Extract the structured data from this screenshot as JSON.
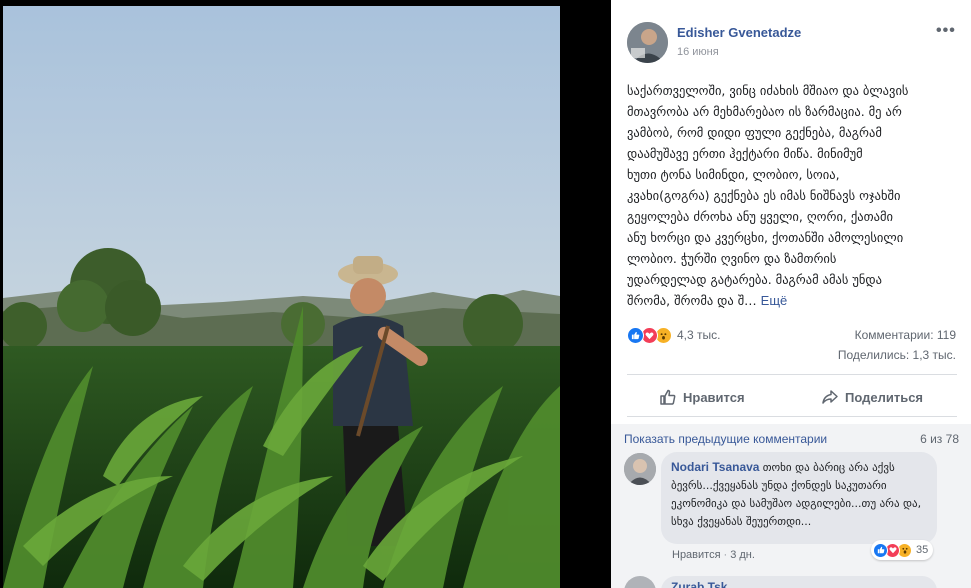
{
  "post": {
    "author": "Edisher Gvenetadze",
    "date": "16 июня",
    "more_label": "•••",
    "text_lines": [
      "საქართველოში, ვინც იძახის მშიაო და ბლავის",
      "მთავრობა არ მეხმარებაო ის ზარმაცია. მე არ",
      "ვამბობ, რომ დიდი ფული გექნება, მაგრამ",
      "დაამუშავე ერთი ჰექტარი მიწა. მინიმუმ",
      "ხუთი ტონა სიმინდი, ლობიო, სოია,",
      "კვახი(გოგრა) გექნება ეს იმას ნიშნავს ოჯახში",
      "გეყოლება ძროხა ანუ ყველი, ღორი, ქათამი",
      "ანუ ხორცი და კვერცხი, ქოთანში ამოლესილი",
      "ლობიო. ჭურში ღვინო და ზამთრის",
      "უდარდელად გატარება. მაგრამ ამას უნდა",
      "შრომა, შრომა და შ…"
    ],
    "see_more": "Ещё",
    "reactions_count": "4,3 тыс.",
    "comments_count": "Комментарии: 119",
    "shares_count": "Поделились: 1,3 тыс.",
    "like_label": "Нравится",
    "share_label": "Поделиться"
  },
  "comments": {
    "show_previous": "Показать предыдущие комментарии",
    "position": "6 из 78",
    "items": [
      {
        "author": "Nodari Tsanava",
        "text": "თოხი და ბარიც არა აქვს ბევრს...ქვეყანას უნდა ქონდეს საკუთარი ეკონომიკა და სამუშაო ადგილები...თუ არა და, სხვა ქვეყანას შეუერთდი...",
        "like_label": "Нравится",
        "separator": "·",
        "time": "3 дн.",
        "reactions_count": "35"
      }
    ],
    "next_author": "Zurab Tsk…"
  },
  "icons": {
    "like": "thumbs-up-icon",
    "love": "heart-icon",
    "wow": "wow-face-icon",
    "share": "share-arrow-icon",
    "more": "more-dots-icon"
  },
  "colors": {
    "link": "#385898",
    "like_blue": "#1877f2",
    "love_red": "#f33e58",
    "wow_yellow": "#f7b125"
  }
}
